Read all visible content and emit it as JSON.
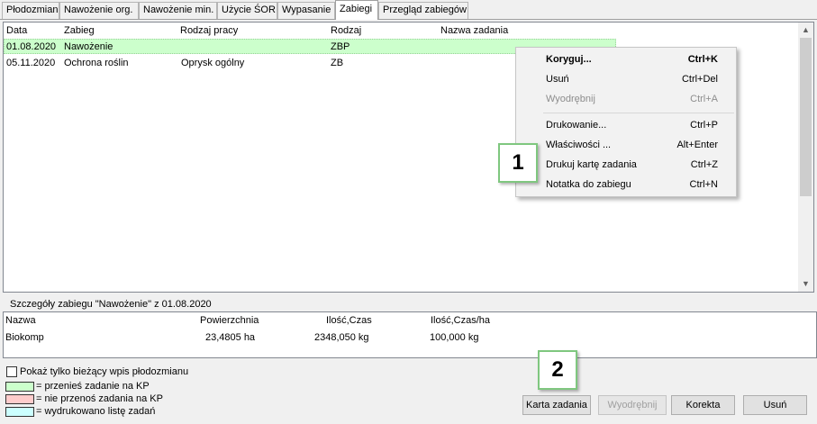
{
  "tabs": [
    {
      "label": "Płodozmian"
    },
    {
      "label": "Nawożenie org."
    },
    {
      "label": "Nawożenie min."
    },
    {
      "label": "Użycie ŚOR"
    },
    {
      "label": "Wypasanie"
    },
    {
      "label": "Zabiegi"
    },
    {
      "label": "Przegląd zabiegów"
    }
  ],
  "list": {
    "columns": [
      "Data",
      "Zabieg",
      "Rodzaj pracy",
      "Rodzaj",
      "Nazwa zadania"
    ],
    "rows": [
      {
        "data": "01.08.2020",
        "zabieg": "Nawożenie",
        "rodzaj_pracy": "",
        "rodzaj": "ZBP",
        "nazwa": ""
      },
      {
        "data": "05.11.2020",
        "zabieg": "Ochrona roślin",
        "rodzaj_pracy": "Oprysk ogólny",
        "rodzaj": "ZB",
        "nazwa": ""
      }
    ],
    "selected_row_color": "#ccffcc"
  },
  "context_menu": {
    "items": [
      {
        "label": "Koryguj...",
        "shortcut": "Ctrl+K"
      },
      {
        "label": "Usuń",
        "shortcut": "Ctrl+Del"
      },
      {
        "label": "Wyodrębnij",
        "shortcut": "Ctrl+A"
      },
      {
        "label": "Drukowanie...",
        "shortcut": "Ctrl+P"
      },
      {
        "label": "Właściwości ...",
        "shortcut": "Alt+Enter"
      },
      {
        "label": "Drukuj kartę zadania",
        "shortcut": "Ctrl+Z"
      },
      {
        "label": "Notatka do zabiegu",
        "shortcut": "Ctrl+N"
      }
    ]
  },
  "callouts": {
    "first": "1",
    "second": "2"
  },
  "details": {
    "label": "Szczegóły zabiegu \"Nawożenie\" z 01.08.2020",
    "columns": [
      "Nazwa",
      "Powierzchnia",
      "Ilość,Czas",
      "Ilość,Czas/ha"
    ],
    "row": {
      "nazwa": "Biokomp",
      "powierzchnia": "23,4805 ha",
      "ilosc": "2348,050 kg",
      "ilosc_ha": "100,000 kg"
    }
  },
  "checkbox_label": "Pokaż tylko bieżący wpis płodozmianu",
  "legend": [
    {
      "text": "= przenieś zadanie na KP",
      "color": "#ccffcc"
    },
    {
      "text": "= nie przenoś zadania na KP",
      "color": "#ffcccc"
    },
    {
      "text": "= wydrukowano listę zadań",
      "color": "#ccffff"
    }
  ],
  "buttons": {
    "karta": "Karta zadania",
    "wyodrebnij": "Wyodrębnij",
    "korekta": "Korekta",
    "usun": "Usuń"
  }
}
